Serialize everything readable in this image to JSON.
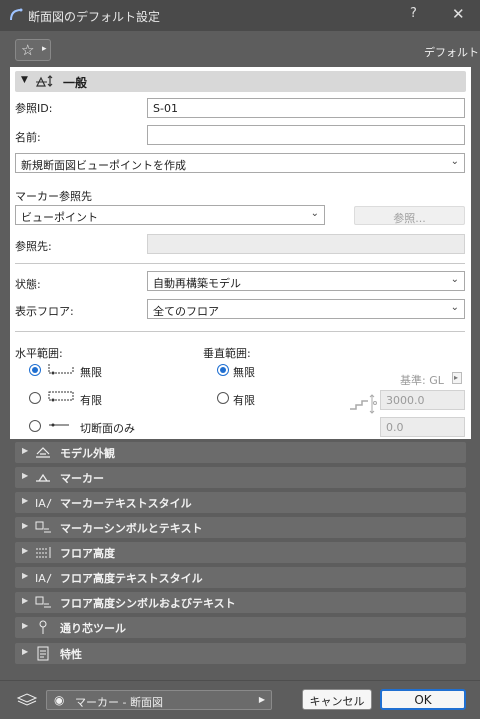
{
  "window": {
    "title": "断面図のデフォルト設定",
    "help_label": "?",
    "close_label": "✕"
  },
  "favorites": {
    "star_glyph": "☆",
    "menu_glyph": "▸",
    "default_label": "デフォルト"
  },
  "general": {
    "title": "一般",
    "ref_id_label": "参照ID:",
    "ref_id_value": "S-01",
    "name_label": "名前:",
    "name_value": "",
    "create_option": "新規断面図ビューポイントを作成",
    "marker_ref_label": "マーカー参照先",
    "marker_ref_value": "ビューポイント",
    "browse_button": "参照...",
    "ref_to_label": "参照先:",
    "ref_to_value": "",
    "status_label": "状態:",
    "status_value": "自動再構築モデル",
    "show_floor_label": "表示フロア:",
    "show_floor_value": "全てのフロア",
    "horizontal_label": "水平範囲:",
    "horizontal_options": [
      "無限",
      "有限",
      "切断面のみ"
    ],
    "horizontal_selected": "無限",
    "vertical_label": "垂直範囲:",
    "vertical_options": [
      "無限",
      "有限"
    ],
    "vertical_selected": "無限",
    "base_label": "基準: GL",
    "top_value": "3000.0",
    "bottom_value": "0.0"
  },
  "sections": [
    {
      "label": "モデル外観",
      "icon": "model-appearance-icon"
    },
    {
      "label": "マーカー",
      "icon": "marker-icon"
    },
    {
      "label": "マーカーテキストスタイル",
      "icon": "text-style-icon"
    },
    {
      "label": "マーカーシンボルとテキスト",
      "icon": "symbol-text-icon"
    },
    {
      "label": "フロア高度",
      "icon": "floor-level-icon"
    },
    {
      "label": "フロア高度テキストスタイル",
      "icon": "text-style-icon"
    },
    {
      "label": "フロア高度シンボルおよびテキスト",
      "icon": "symbol-text-icon"
    },
    {
      "label": "通り芯ツール",
      "icon": "grid-tool-icon"
    },
    {
      "label": "特性",
      "icon": "properties-icon"
    }
  ],
  "footer": {
    "layer_value": "マーカー - 断面図",
    "cancel_label": "キャンセル",
    "ok_label": "OK"
  },
  "colors": {
    "accent": "#1f6fd1",
    "dialog_bg": "#5d5d5d",
    "section_bg": "#6b6b6b",
    "panel_bg": "#ffffff"
  }
}
